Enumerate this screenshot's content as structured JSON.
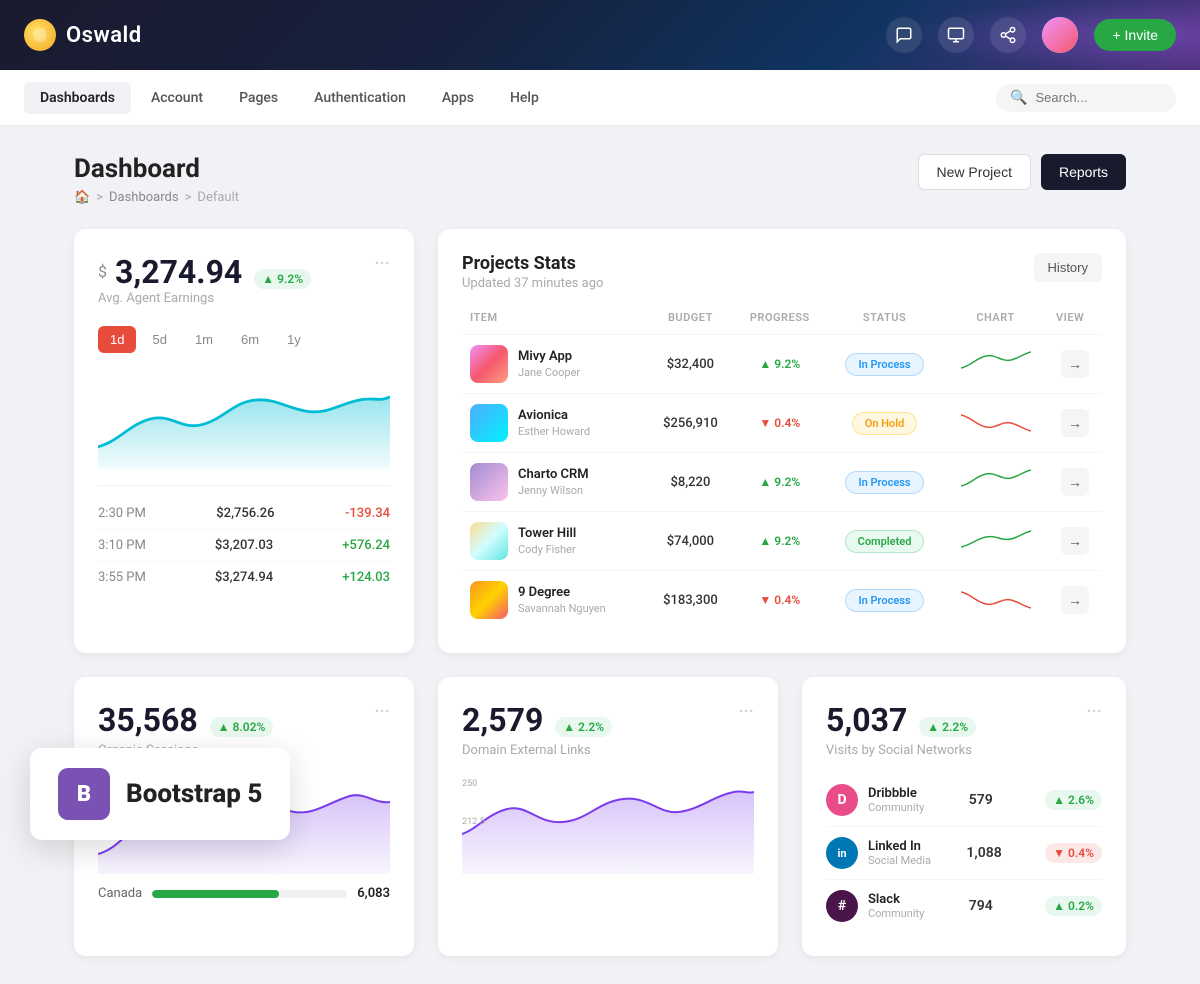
{
  "topbar": {
    "logo_text": "Oswald",
    "invite_label": "+ Invite"
  },
  "nav": {
    "items": [
      {
        "label": "Dashboards",
        "active": true
      },
      {
        "label": "Account",
        "active": false
      },
      {
        "label": "Pages",
        "active": false
      },
      {
        "label": "Authentication",
        "active": false
      },
      {
        "label": "Apps",
        "active": false
      },
      {
        "label": "Help",
        "active": false
      }
    ],
    "search_placeholder": "Search..."
  },
  "page": {
    "title": "Dashboard",
    "breadcrumb": [
      "home",
      "Dashboards",
      "Default"
    ],
    "btn_new_project": "New Project",
    "btn_reports": "Reports"
  },
  "earnings_card": {
    "currency": "$",
    "amount": "3,274.94",
    "badge": "9.2%",
    "label": "Avg. Agent Earnings",
    "time_filters": [
      "1d",
      "5d",
      "1m",
      "6m",
      "1y"
    ],
    "active_filter": "1d",
    "rows": [
      {
        "time": "2:30 PM",
        "amount": "$2,756.26",
        "change": "-139.34",
        "positive": false
      },
      {
        "time": "3:10 PM",
        "amount": "$3,207.03",
        "change": "+576.24",
        "positive": true
      },
      {
        "time": "3:55 PM",
        "amount": "$3,274.94",
        "change": "+124.03",
        "positive": true
      }
    ]
  },
  "projects_card": {
    "title": "Projects Stats",
    "subtitle": "Updated 37 minutes ago",
    "history_btn": "History",
    "columns": [
      "ITEM",
      "BUDGET",
      "PROGRESS",
      "STATUS",
      "CHART",
      "VIEW"
    ],
    "rows": [
      {
        "name": "Mivy App",
        "sub": "Jane Cooper",
        "thumb": "mivy",
        "budget": "$32,400",
        "progress": "9.2%",
        "progress_up": true,
        "status": "In Process",
        "status_type": "inprocess"
      },
      {
        "name": "Avionica",
        "sub": "Esther Howard",
        "thumb": "avionica",
        "budget": "$256,910",
        "progress": "0.4%",
        "progress_up": false,
        "status": "On Hold",
        "status_type": "onhold"
      },
      {
        "name": "Charto CRM",
        "sub": "Jenny Wilson",
        "thumb": "charto",
        "budget": "$8,220",
        "progress": "9.2%",
        "progress_up": true,
        "status": "In Process",
        "status_type": "inprocess"
      },
      {
        "name": "Tower Hill",
        "sub": "Cody Fisher",
        "thumb": "tower",
        "budget": "$74,000",
        "progress": "9.2%",
        "progress_up": true,
        "status": "Completed",
        "status_type": "completed"
      },
      {
        "name": "9 Degree",
        "sub": "Savannah Nguyen",
        "thumb": "9degree",
        "budget": "$183,300",
        "progress": "0.4%",
        "progress_up": false,
        "status": "In Process",
        "status_type": "inprocess"
      }
    ]
  },
  "sessions_card": {
    "number": "35,568",
    "badge": "8.02%",
    "label": "Organic Sessions",
    "country": "Canada",
    "country_val": "6,083",
    "country_pct": 65
  },
  "domain_card": {
    "number": "2,579",
    "badge": "2.2%",
    "label": "Domain External Links"
  },
  "social_card": {
    "number": "5,037",
    "badge": "2.2%",
    "label": "Visits by Social Networks",
    "rows": [
      {
        "name": "Dribbble",
        "type": "Community",
        "val": "579",
        "badge": "2.6%",
        "badge_up": true,
        "icon": "D",
        "icon_class": "icon-dribbble"
      },
      {
        "name": "Linked In",
        "type": "Social Media",
        "val": "1,088",
        "badge": "0.4%",
        "badge_up": false,
        "icon": "in",
        "icon_class": "icon-linkedin"
      },
      {
        "name": "Slack",
        "type": "Community",
        "val": "794",
        "badge": "0.2%",
        "badge_up": true,
        "icon": "S",
        "icon_class": "icon-slack"
      }
    ]
  },
  "bootstrap_badge": {
    "icon": "B",
    "text": "Bootstrap 5"
  }
}
